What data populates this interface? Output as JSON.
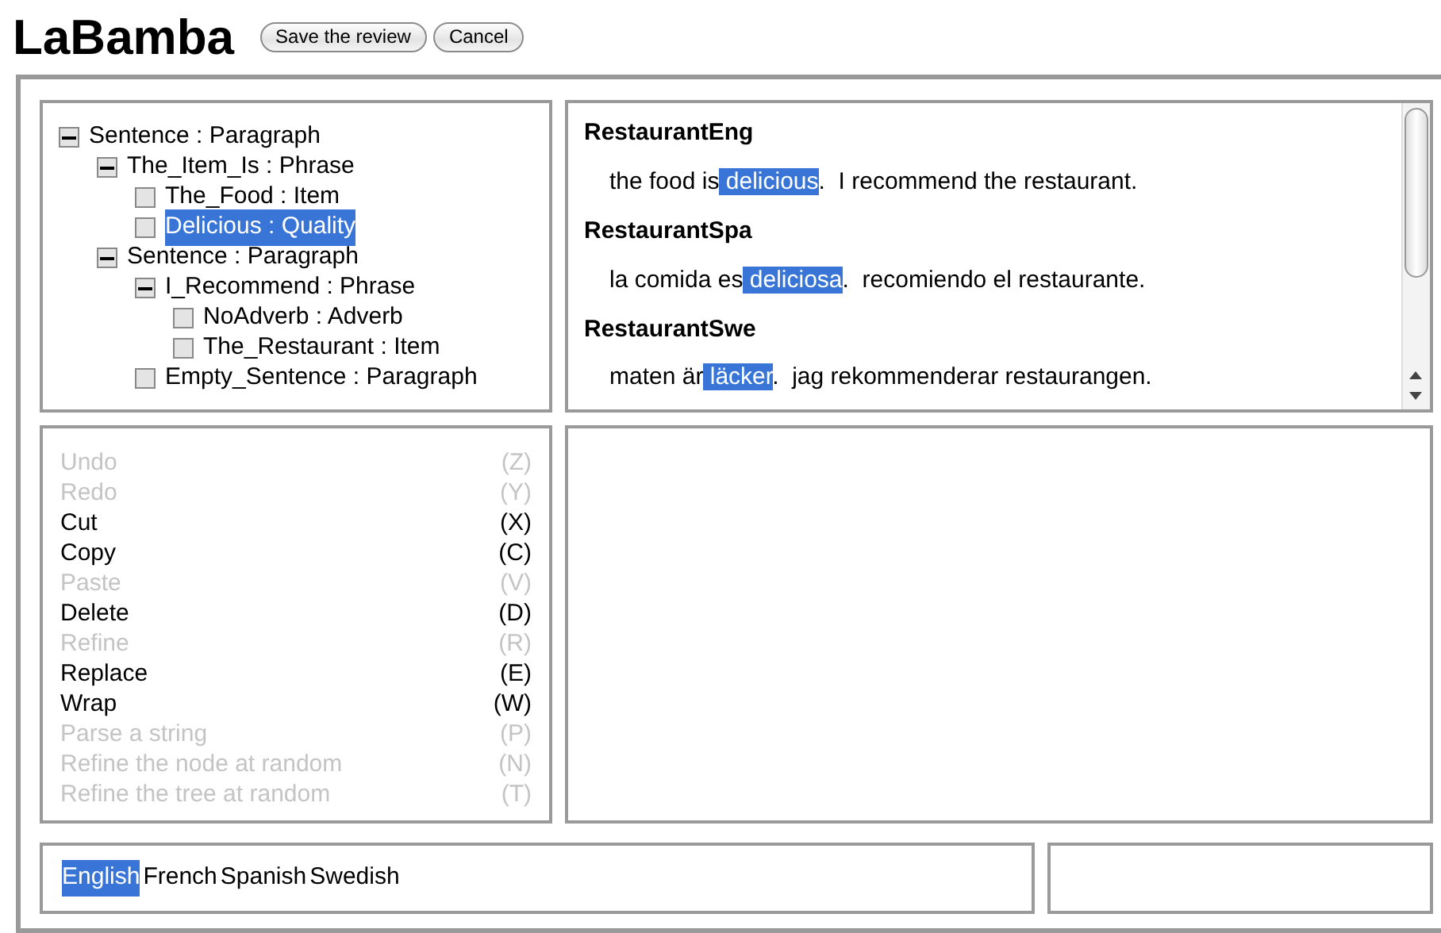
{
  "title": "LaBamba",
  "buttons": [
    "Save the review",
    "Cancel"
  ],
  "tree": [
    {
      "label": "Sentence : Paragraph",
      "expanded": true,
      "selected": false,
      "children": [
        {
          "label": "The_Item_Is : Phrase",
          "expanded": true,
          "selected": false,
          "children": [
            {
              "label": "The_Food : Item",
              "expanded": false,
              "selected": false
            },
            {
              "label": "Delicious : Quality",
              "expanded": false,
              "selected": true
            }
          ]
        },
        {
          "label": "Sentence : Paragraph",
          "expanded": true,
          "selected": false,
          "children": [
            {
              "label": "I_Recommend : Phrase",
              "expanded": true,
              "selected": false,
              "children": [
                {
                  "label": "NoAdverb : Adverb",
                  "expanded": false,
                  "selected": false
                },
                {
                  "label": "The_Restaurant : Item",
                  "expanded": false,
                  "selected": false
                }
              ]
            },
            {
              "label": "Empty_Sentence : Paragraph",
              "expanded": false,
              "selected": false
            }
          ]
        }
      ]
    }
  ],
  "linearizations": [
    {
      "name": "RestaurantEng",
      "segments": [
        {
          "text": "the food is",
          "selected": false
        },
        {
          "text": " delicious",
          "selected": true
        },
        {
          "text": ".  I recommend the restaurant.",
          "selected": false
        }
      ]
    },
    {
      "name": "RestaurantSpa",
      "segments": [
        {
          "text": "la comida es",
          "selected": false
        },
        {
          "text": " deliciosa",
          "selected": true
        },
        {
          "text": ".  recomiendo el restaurante.",
          "selected": false
        }
      ]
    },
    {
      "name": "RestaurantSwe",
      "segments": [
        {
          "text": "maten är",
          "selected": false
        },
        {
          "text": " läcker",
          "selected": true
        },
        {
          "text": ".  jag rekommenderar restaurangen.",
          "selected": false
        }
      ]
    }
  ],
  "commands": [
    {
      "label": "Undo",
      "key": "(Z)",
      "disabled": true
    },
    {
      "label": "Redo",
      "key": "(Y)",
      "disabled": true
    },
    {
      "label": "Cut",
      "key": "(X)",
      "disabled": false
    },
    {
      "label": "Copy",
      "key": "(C)",
      "disabled": false
    },
    {
      "label": "Paste",
      "key": "(V)",
      "disabled": true
    },
    {
      "label": "Delete",
      "key": "(D)",
      "disabled": false
    },
    {
      "label": "Refine",
      "key": "(R)",
      "disabled": true
    },
    {
      "label": "Replace",
      "key": "(E)",
      "disabled": false
    },
    {
      "label": "Wrap",
      "key": "(W)",
      "disabled": false
    },
    {
      "label": "Parse a string",
      "key": "(P)",
      "disabled": true
    },
    {
      "label": "Refine the node at random",
      "key": "(N)",
      "disabled": true
    },
    {
      "label": "Refine the tree at random",
      "key": "(T)",
      "disabled": true
    }
  ],
  "languages": [
    {
      "name": "English",
      "selected": true
    },
    {
      "name": "French",
      "selected": false
    },
    {
      "name": "Spanish",
      "selected": false
    },
    {
      "name": "Swedish",
      "selected": false
    }
  ]
}
